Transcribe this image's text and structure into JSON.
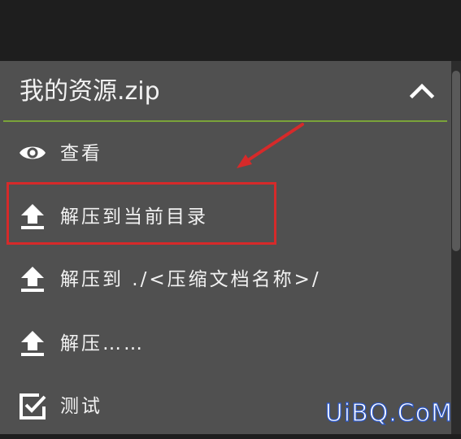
{
  "header": {
    "title": "我的资源.zip",
    "collapse_icon": "chevron-up-icon",
    "divider_color": "#7aa33a"
  },
  "menu": {
    "items": [
      {
        "label": "查看",
        "icon": "eye-icon"
      },
      {
        "label": "解压到当前目录",
        "icon": "upload-icon"
      },
      {
        "label": "解压到 ./<压缩文档名称>/",
        "icon": "upload-icon"
      },
      {
        "label": "解压……",
        "icon": "upload-icon"
      },
      {
        "label": "测试",
        "icon": "checkbox-icon"
      }
    ]
  },
  "annotation": {
    "highlight_color": "#d62a2a",
    "highlighted_item": "解压到当前目录"
  },
  "watermark": {
    "text": "UiBQ.CoM"
  }
}
